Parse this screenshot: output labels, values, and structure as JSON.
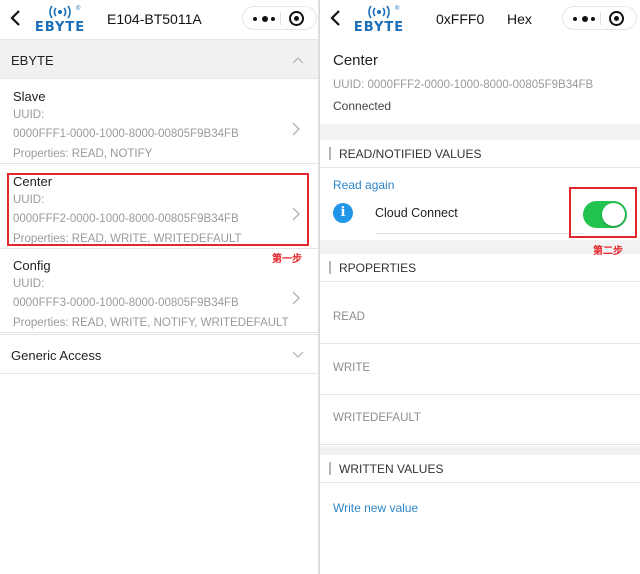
{
  "left": {
    "nav": {
      "title": "E104-BT5011A",
      "logo_text": "EBYTE",
      "logo_reg": "®"
    },
    "group": {
      "title": "EBYTE"
    },
    "services": [
      {
        "name": "Slave",
        "uuid_label": "UUID:",
        "uuid": "0000FFF1-0000-1000-8000-00805F9B34FB",
        "properties": "Properties: READ, NOTIFY"
      },
      {
        "name": "Center",
        "uuid_label": "UUID:",
        "uuid": "0000FFF2-0000-1000-8000-00805F9B34FB",
        "properties": "Properties: READ, WRITE, WRITEDEFAULT"
      },
      {
        "name": "Config",
        "uuid_label": "UUID:",
        "uuid": "0000FFF3-0000-1000-8000-00805F9B34FB",
        "properties": "Properties: READ, WRITE, NOTIFY, WRITEDEFAULT"
      }
    ],
    "generic_access": {
      "title": "Generic Access"
    },
    "step_label": "第一步"
  },
  "right": {
    "nav": {
      "title": "0xFFF0",
      "mode": "Hex",
      "logo_text": "EBYTE",
      "logo_reg": "®"
    },
    "characteristic": {
      "name": "Center",
      "uuid": "UUID: 0000FFF2-0000-1000-8000-00805F9B34FB",
      "status": "Connected"
    },
    "read_section": {
      "title": "READ/NOTIFIED VALUES",
      "read_again": "Read again",
      "info_icon": "i",
      "cloud_connect_label": "Cloud Connect",
      "cloud_connect_on": true
    },
    "properties_section": {
      "title": "RPOPERTIES",
      "items": [
        "READ",
        "WRITE",
        "WRITEDEFAULT"
      ]
    },
    "written_section": {
      "title": "WRITTEN VALUES",
      "write_new": "Write new value"
    },
    "step_label": "第二步"
  },
  "colors": {
    "link": "#2f86c8",
    "toggle_on": "#22c34e",
    "highlight": "#e3262c",
    "brand": "#1b6fb8",
    "info": "#2196e8"
  },
  "icons": {
    "back": "chevron-left-icon",
    "more": "more-dots-icon",
    "close": "target-circle-icon",
    "expand": "chevron-up-icon",
    "collapse": "chevron-down-icon",
    "open": "chevron-right-icon",
    "info": "info-icon"
  }
}
